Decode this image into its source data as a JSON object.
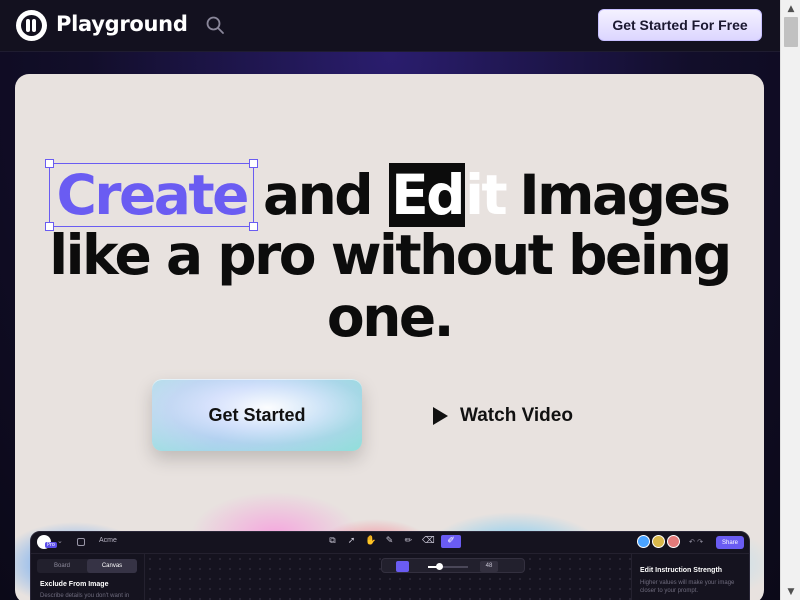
{
  "header": {
    "brand": "Playground",
    "cta_label": "Get Started For Free"
  },
  "hero": {
    "headline": {
      "create": "Create",
      "and": "and",
      "edit_highlight": "Ed",
      "edit_rest": "it",
      "images": "Images",
      "line2": "like a pro without being",
      "line3": "one."
    },
    "primary_button": "Get Started",
    "video_button": "Watch Video"
  },
  "app_preview": {
    "project_name": "Acme",
    "tag": "Pro",
    "segments": [
      "Board",
      "Canvas"
    ],
    "active_segment": "Canvas",
    "left_title": "Exclude From Image",
    "left_hint": "Describe details you don't want in",
    "zoom_value": "48",
    "share_label": "Share",
    "right_title": "Edit Instruction Strength",
    "right_hint": "Higher values will make your image closer to your prompt."
  },
  "colors": {
    "accent": "#6a5cf2",
    "hero_bg": "#e8e2df",
    "nav_bg": "#13111f"
  }
}
